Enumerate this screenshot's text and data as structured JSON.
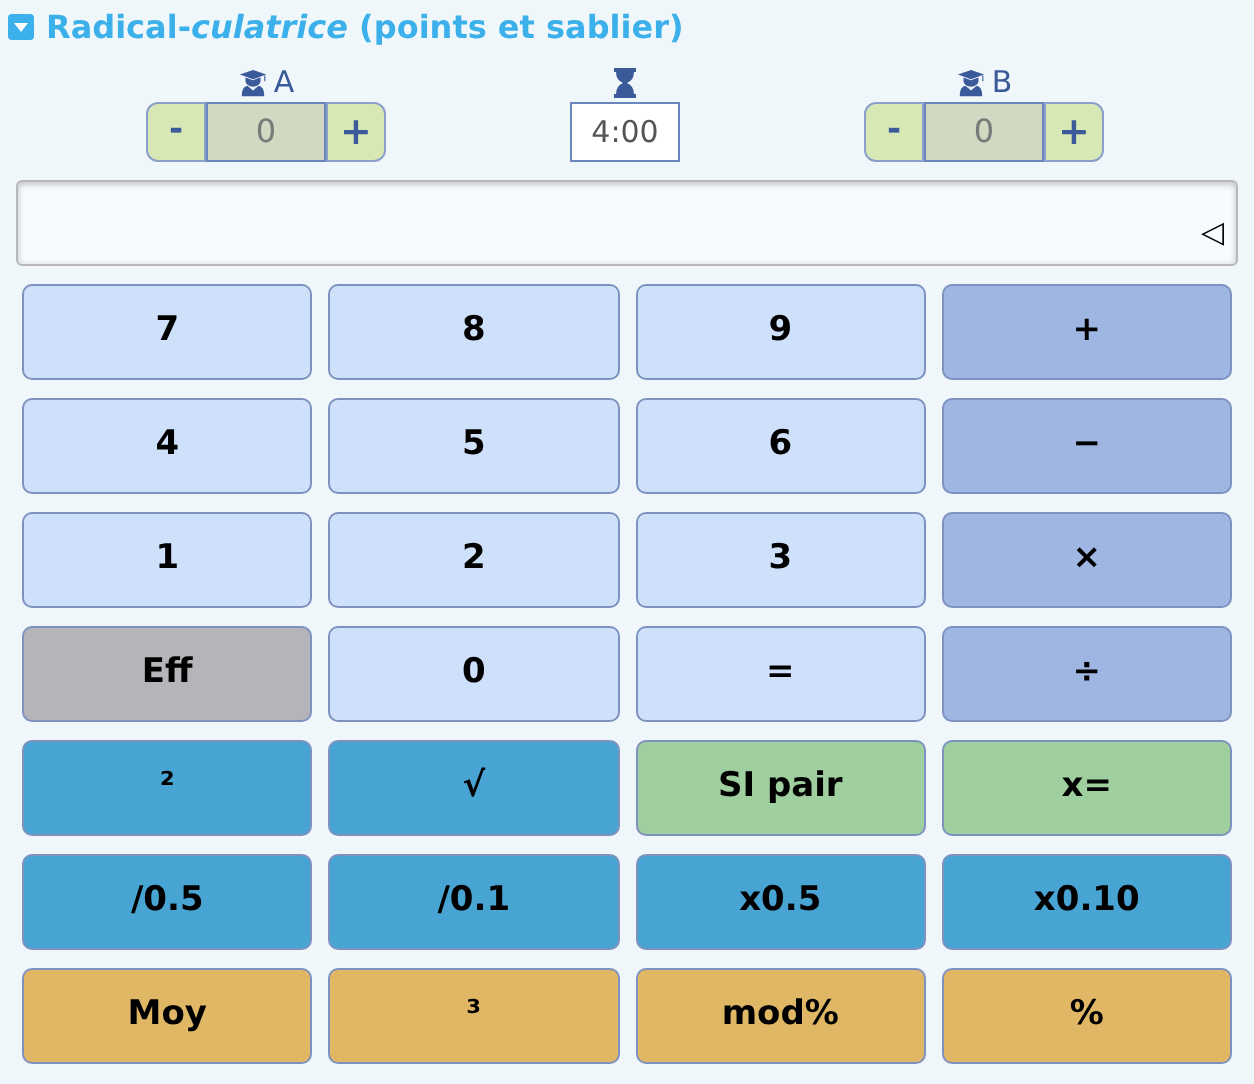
{
  "panel": {
    "title": "Radical-*culatrice* (points et sablier)",
    "expanded": true
  },
  "scores": [
    {
      "team": "A",
      "minus": "-",
      "value": "0",
      "plus": "+"
    },
    {
      "team": "B",
      "minus": "-",
      "value": "0",
      "plus": "+"
    }
  ],
  "timer": {
    "value": "4:00"
  },
  "display": {
    "arrow": "◁"
  },
  "keys": [
    {
      "label": "7",
      "kind": "num"
    },
    {
      "label": "8",
      "kind": "num"
    },
    {
      "label": "9",
      "kind": "num"
    },
    {
      "label": "+",
      "kind": "op"
    },
    {
      "label": "4",
      "kind": "num"
    },
    {
      "label": "5",
      "kind": "num"
    },
    {
      "label": "6",
      "kind": "num"
    },
    {
      "label": "−",
      "kind": "op"
    },
    {
      "label": "1",
      "kind": "num"
    },
    {
      "label": "2",
      "kind": "num"
    },
    {
      "label": "3",
      "kind": "num"
    },
    {
      "label": "×",
      "kind": "op"
    },
    {
      "label": "Eff",
      "kind": "clear"
    },
    {
      "label": "0",
      "kind": "num"
    },
    {
      "label": "=",
      "kind": "num"
    },
    {
      "label": "÷",
      "kind": "op"
    },
    {
      "label": "²",
      "kind": "sci"
    },
    {
      "label": "√",
      "kind": "sci"
    },
    {
      "label": "SI pair",
      "kind": "logic"
    },
    {
      "label": "x=",
      "kind": "logic"
    },
    {
      "label": "/0.5",
      "kind": "sci"
    },
    {
      "label": "/0.1",
      "kind": "sci"
    },
    {
      "label": "x0.5",
      "kind": "sci"
    },
    {
      "label": "x0.10",
      "kind": "sci"
    },
    {
      "label": "Moy",
      "kind": "stat"
    },
    {
      "label": "³",
      "kind": "stat"
    },
    {
      "label": "mod%",
      "kind": "stat"
    },
    {
      "label": "%",
      "kind": "stat"
    }
  ]
}
